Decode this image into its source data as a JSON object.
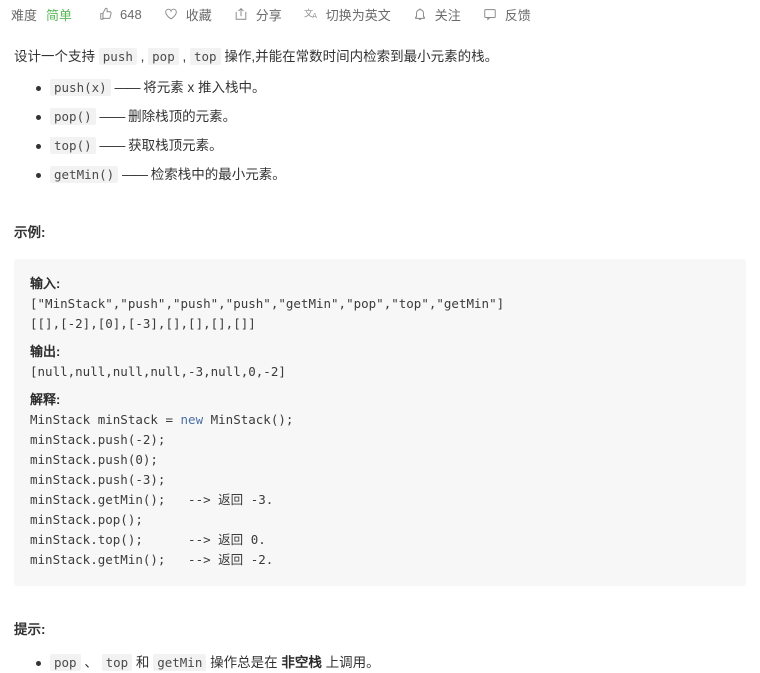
{
  "toolbar": {
    "difficulty_label": "难度",
    "difficulty_value": "简单",
    "difficulty_color": "#5cb85c",
    "like_icon": "thumbs-up-icon",
    "like_count": "648",
    "favorite_icon": "heart-icon",
    "favorite_label": "收藏",
    "share_icon": "share-icon",
    "share_label": "分享",
    "translate_icon": "translate-icon",
    "translate_label": "切换为英文",
    "follow_icon": "bell-icon",
    "follow_label": "关注",
    "feedback_icon": "comment-icon",
    "feedback_label": "反馈"
  },
  "description": {
    "part1": "设计一个支持 ",
    "code1": "push",
    "sep1": " , ",
    "code2": "pop",
    "sep2": " , ",
    "code3": "top",
    "part2": " 操作,并能在常数时间内检索到最小元素的栈。"
  },
  "operations": [
    {
      "code": "push(x)",
      "dash": "——",
      "text": "将元素 x 推入栈中。"
    },
    {
      "code": "pop()",
      "dash": "——",
      "text": "删除栈顶的元素。"
    },
    {
      "code": "top()",
      "dash": "——",
      "text": "获取栈顶元素。"
    },
    {
      "code": "getMin()",
      "dash": "——",
      "text": "检索栈中的最小元素。"
    }
  ],
  "example": {
    "title": "示例:",
    "input_label": "输入:",
    "input_line1": "[\"MinStack\",\"push\",\"push\",\"push\",\"getMin\",\"pop\",\"top\",\"getMin\"]",
    "input_line2": "[[],[-2],[0],[-3],[],[],[],[]]",
    "output_label": "输出:",
    "output_line": "[null,null,null,null,-3,null,0,-2]",
    "explain_label": "解释:",
    "explain_line1_a": "MinStack minStack = ",
    "explain_line1_kw": "new",
    "explain_line1_b": " MinStack();",
    "explain_line2": "minStack.push(-2);",
    "explain_line3": "minStack.push(0);",
    "explain_line4": "minStack.push(-3);",
    "explain_line5_a": "minStack.getMin();   --> ",
    "explain_line5_cn": "返回",
    "explain_line5_b": " -3.",
    "explain_line6": "minStack.pop();",
    "explain_line7_a": "minStack.top();      --> ",
    "explain_line7_cn": "返回",
    "explain_line7_b": " 0.",
    "explain_line8_a": "minStack.getMin();   --> ",
    "explain_line8_cn": "返回",
    "explain_line8_b": " -2."
  },
  "hints": {
    "title": "提示:",
    "item": {
      "code1": "pop",
      "sep1": " 、 ",
      "code2": "top",
      "sep2": " 和 ",
      "code3": "getMin",
      "text1": " 操作总是在 ",
      "strong": "非空栈",
      "text2": " 上调用。"
    }
  }
}
